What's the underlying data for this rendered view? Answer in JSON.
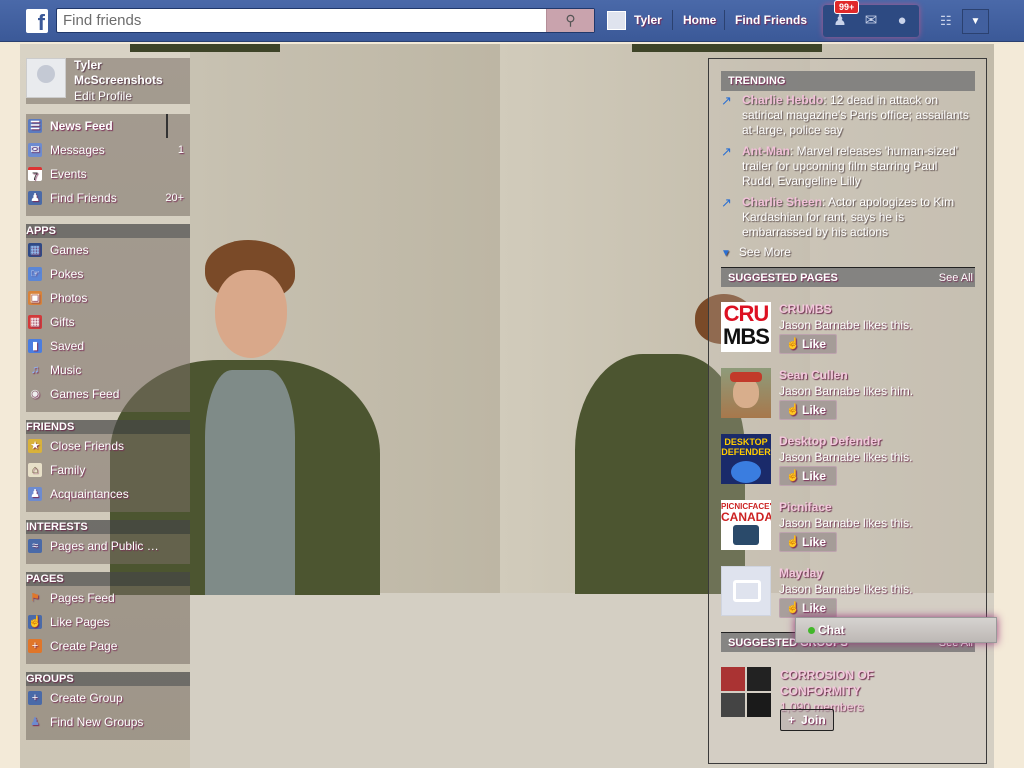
{
  "topbar": {
    "logo_letter": "f",
    "search_placeholder": "Find friends",
    "search_icon": "magnifier-icon",
    "user_name": "Tyler",
    "home_label": "Home",
    "find_friends_label": "Find Friends",
    "notification_badge": "99+",
    "brand_color": "#3b5998"
  },
  "profile": {
    "name": "Tyler McScreenshots",
    "edit_label": "Edit Profile"
  },
  "nav": {
    "favorites": [
      {
        "label": "News Feed",
        "icon": "news-feed-icon",
        "count": ""
      },
      {
        "label": "Messages",
        "icon": "messages-icon",
        "count": "1"
      },
      {
        "label": "Events",
        "icon": "calendar-icon",
        "icon_text": "7",
        "count": ""
      },
      {
        "label": "Find Friends",
        "icon": "find-friends-icon",
        "count": "20+"
      }
    ],
    "apps_header": "APPS",
    "apps": [
      {
        "label": "Games",
        "icon": "games-icon"
      },
      {
        "label": "Pokes",
        "icon": "pokes-icon"
      },
      {
        "label": "Photos",
        "icon": "photos-icon"
      },
      {
        "label": "Gifts",
        "icon": "gift-icon"
      },
      {
        "label": "Saved",
        "icon": "bookmark-icon"
      },
      {
        "label": "Music",
        "icon": "music-icon"
      },
      {
        "label": "Games Feed",
        "icon": "gamepad-icon"
      }
    ],
    "friends_header": "FRIENDS",
    "friends": [
      {
        "label": "Close Friends",
        "icon": "star-friend-icon"
      },
      {
        "label": "Family",
        "icon": "family-icon"
      },
      {
        "label": "Acquaintances",
        "icon": "acquaintances-icon"
      }
    ],
    "interests_header": "INTERESTS",
    "interests": [
      {
        "label": "Pages and Public …",
        "icon": "rss-icon"
      }
    ],
    "pages_header": "PAGES",
    "pages": [
      {
        "label": "Pages Feed",
        "icon": "flag-icon"
      },
      {
        "label": "Like Pages",
        "icon": "thumbs-up-icon"
      },
      {
        "label": "Create Page",
        "icon": "create-page-icon"
      }
    ],
    "groups_header": "GROUPS",
    "groups": [
      {
        "label": "Create Group",
        "icon": "create-group-icon"
      },
      {
        "label": "Find New Groups",
        "icon": "find-groups-icon"
      }
    ]
  },
  "trending": {
    "header": "TRENDING",
    "items": [
      {
        "topic": "Charlie Hebdo",
        "text": ": 12 dead in attack on satirical magazine's Paris office; assailants at-large, police say"
      },
      {
        "topic": "Ant-Man",
        "text": ": Marvel releases 'human-sized' trailer for upcoming film starring Paul Rudd, Evangeline Lilly"
      },
      {
        "topic": "Charlie Sheen",
        "text": ": Actor apologizes to Kim Kardashian for rant, says he is embarrassed by his actions"
      }
    ],
    "see_more": "See More"
  },
  "suggested_pages": {
    "header": "SUGGESTED PAGES",
    "see_all": "See All",
    "like_label": "Like",
    "items": [
      {
        "name": "CRUMBS",
        "sub": "Jason Barnabe likes this.",
        "thumb_top": "CRU",
        "thumb_bottom": "MBS"
      },
      {
        "name": "Sean Cullen",
        "sub": "Jason Barnabe likes him."
      },
      {
        "name": "Desktop Defender",
        "sub": "Jason Barnabe likes this.",
        "thumb_text": "DESKTOP DEFENDER"
      },
      {
        "name": "Picniface",
        "sub": "Jason Barnabe likes this.",
        "thumb_top": "PICNICFACE'S",
        "thumb_bottom": "CANADA"
      },
      {
        "name": "Mayday",
        "sub": "Jason Barnabe likes this."
      }
    ]
  },
  "suggested_groups": {
    "header": "SUGGESTED GROUPS",
    "see_all": "See All",
    "name": "CORROSION OF CONFORMITY",
    "members": "1,090 members",
    "join_label": "Join"
  },
  "chat": {
    "label": "Chat",
    "status_color": "#42b72a"
  }
}
